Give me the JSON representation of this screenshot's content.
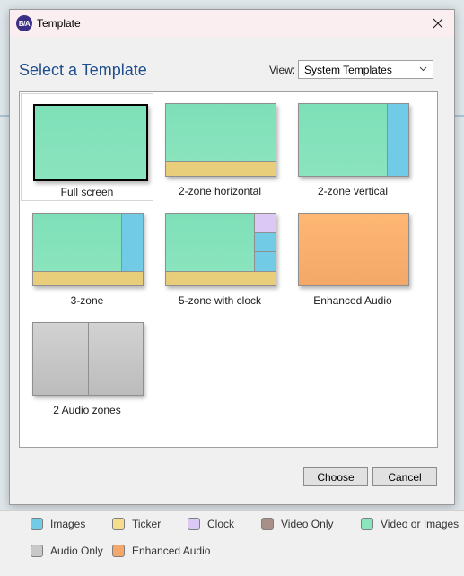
{
  "window": {
    "title": "Template",
    "icon_text": "B/A"
  },
  "header": {
    "heading": "Select a Template",
    "view_label": "View:",
    "view_value": "System Templates"
  },
  "templates": [
    {
      "label": "Full screen",
      "selected": true
    },
    {
      "label": "2-zone horizontal"
    },
    {
      "label": "2-zone vertical"
    },
    {
      "label": "3-zone"
    },
    {
      "label": "5-zone with clock"
    },
    {
      "label": "Enhanced Audio"
    },
    {
      "label": "2 Audio zones"
    }
  ],
  "buttons": {
    "choose": "Choose",
    "cancel": "Cancel"
  },
  "legend": [
    {
      "label": "Images",
      "color": "#72cbe6"
    },
    {
      "label": "Ticker",
      "color": "#f5dd8c"
    },
    {
      "label": "Clock",
      "color": "#dcc8f4"
    },
    {
      "label": "Video Only",
      "color": "#a89088"
    },
    {
      "label": "Video or Images",
      "color": "#8ae4be"
    },
    {
      "label": "Audio Only",
      "color": "#c8c8c8"
    },
    {
      "label": "Enhanced Audio",
      "color": "#f6a86a"
    }
  ]
}
